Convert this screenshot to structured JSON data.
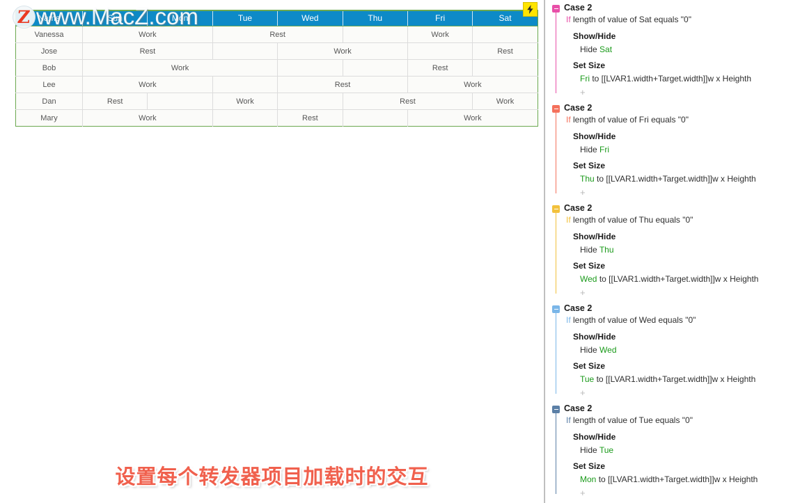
{
  "canvas": {
    "watermark": {
      "logo_letter": "Z",
      "text": "www.MacZ.com"
    },
    "badge": {
      "icon": "lightning-bolt-icon"
    },
    "caption": "设置每个转发器项目加载时的交互"
  },
  "schedule": {
    "columns": [
      "Name",
      "Sun",
      "Mon",
      "Tue",
      "Wed",
      "Thu",
      "Fri",
      "Sat"
    ],
    "rows": [
      {
        "name": "Vanessa",
        "cells": [
          {
            "text": "Work",
            "span": 2,
            "tint": "t-white"
          },
          {
            "text": "Rest",
            "span": 2,
            "tint": "t-pale"
          },
          {
            "text": "",
            "span": 1,
            "tint": "t-white"
          },
          {
            "text": "Work",
            "span": 1,
            "tint": "t-pale"
          },
          {
            "text": "",
            "span": 1,
            "tint": "t-lite"
          }
        ]
      },
      {
        "name": "Jose",
        "cells": [
          {
            "text": "Rest",
            "span": 2,
            "tint": "t-white"
          },
          {
            "text": "",
            "span": 1,
            "tint": "t-white"
          },
          {
            "text": "Work",
            "span": 2,
            "tint": "t-pale"
          },
          {
            "text": "",
            "span": 1,
            "tint": "t-yell"
          },
          {
            "text": "Rest",
            "span": 1,
            "tint": "t-white"
          }
        ]
      },
      {
        "name": "Bob",
        "cells": [
          {
            "text": "Work",
            "span": 3,
            "tint": "t-white"
          },
          {
            "text": "",
            "span": 1,
            "tint": "t-lite"
          },
          {
            "text": "",
            "span": 1,
            "tint": "t-white"
          },
          {
            "text": "Rest",
            "span": 1,
            "tint": "t-pale"
          },
          {
            "text": "",
            "span": 1,
            "tint": "t-lite"
          }
        ]
      },
      {
        "name": "Lee",
        "cells": [
          {
            "text": "Work",
            "span": 2,
            "tint": "t-white"
          },
          {
            "text": "",
            "span": 1,
            "tint": "t-pale"
          },
          {
            "text": "Rest",
            "span": 2,
            "tint": "t-white"
          },
          {
            "text": "Work",
            "span": 2,
            "tint": "t-pale"
          }
        ]
      },
      {
        "name": "Dan",
        "cells": [
          {
            "text": "Rest",
            "span": 1,
            "tint": "t-white"
          },
          {
            "text": "",
            "span": 1,
            "tint": "t-white"
          },
          {
            "text": "Work",
            "span": 1,
            "tint": "t-pale"
          },
          {
            "text": "",
            "span": 1,
            "tint": "t-yell"
          },
          {
            "text": "Rest",
            "span": 2,
            "tint": "t-pale"
          },
          {
            "text": "Work",
            "span": 1,
            "tint": "t-white"
          }
        ]
      },
      {
        "name": "Mary",
        "cells": [
          {
            "text": "Work",
            "span": 2,
            "tint": "t-white"
          },
          {
            "text": "",
            "span": 1,
            "tint": "t-white"
          },
          {
            "text": "Rest",
            "span": 1,
            "tint": "t-pale"
          },
          {
            "text": "",
            "span": 1,
            "tint": "t-lite"
          },
          {
            "text": "Work",
            "span": 2,
            "tint": "t-pale"
          }
        ]
      }
    ]
  },
  "panel": {
    "cases": [
      {
        "title": "Case 2",
        "if_keyword": "If",
        "condition": "length of value of Sat equals \"0\"",
        "color": "#e84fa8",
        "show_hide_label": "Show/Hide",
        "hide_prefix": "Hide",
        "hide_target": "Sat",
        "set_size_label": "Set Size",
        "size_target": "Fri",
        "size_rest": "to [[LVAR1.width+Target.width]]w x Heighth",
        "add_icon": "+"
      },
      {
        "title": "Case 2",
        "if_keyword": "If",
        "condition": "length of value of Fri equals \"0\"",
        "color": "#f4715c",
        "show_hide_label": "Show/Hide",
        "hide_prefix": "Hide",
        "hide_target": "Fri",
        "set_size_label": "Set Size",
        "size_target": "Thu",
        "size_rest": "to [[LVAR1.width+Target.width]]w x Heighth",
        "add_icon": "+"
      },
      {
        "title": "Case 2",
        "if_keyword": "If",
        "condition": "length of value of Thu equals \"0\"",
        "color": "#f2c13c",
        "show_hide_label": "Show/Hide",
        "hide_prefix": "Hide",
        "hide_target": "Thu",
        "set_size_label": "Set Size",
        "size_target": "Wed",
        "size_rest": "to [[LVAR1.width+Target.width]]w x Heighth",
        "add_icon": "+"
      },
      {
        "title": "Case 2",
        "if_keyword": "If",
        "condition": "length of value of Wed equals \"0\"",
        "color": "#7ab6e8",
        "show_hide_label": "Show/Hide",
        "hide_prefix": "Hide",
        "hide_target": "Wed",
        "set_size_label": "Set Size",
        "size_target": "Tue",
        "size_rest": "to [[LVAR1.width+Target.width]]w x Heighth",
        "add_icon": "+"
      },
      {
        "title": "Case 2",
        "if_keyword": "If",
        "condition": "length of value of Tue equals \"0\"",
        "color": "#5b7fa6",
        "show_hide_label": "Show/Hide",
        "hide_prefix": "Hide",
        "hide_target": "Tue",
        "set_size_label": "Set Size",
        "size_target": "Mon",
        "size_rest": "to [[LVAR1.width+Target.width]]w x Heighth",
        "add_icon": "+"
      }
    ]
  }
}
